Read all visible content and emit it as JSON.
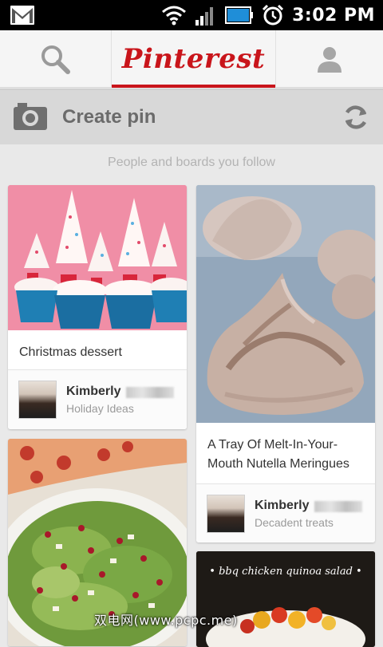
{
  "status_bar": {
    "time": "3:02 PM",
    "icons": [
      "gmail-icon",
      "wifi-icon",
      "signal-icon",
      "battery-icon",
      "alarm-icon"
    ]
  },
  "topbar": {
    "logo": "Pinterest",
    "tabs": [
      "search-icon",
      "pinterest-logo",
      "profile-icon"
    ],
    "accent": "#c9151b"
  },
  "create_bar": {
    "label": "Create pin",
    "icons": [
      "camera-icon",
      "refresh-icon"
    ]
  },
  "feed": {
    "section_title": "People and boards you follow",
    "pins": [
      {
        "description": "Christmas dessert",
        "owner": "Kimberly",
        "board": "Holiday Ideas",
        "image": "cupcakes with tree toppers"
      },
      {
        "description": "A Tray Of Melt-In-Your-Mouth Nutella Meringues",
        "owner": "Kimberly",
        "board": "Decadent treats",
        "image": "nutella meringue"
      },
      {
        "description": "",
        "image": "salad"
      },
      {
        "description": "",
        "image": "bbq chicken quinoa salad",
        "image_text": "• bbq chicken quinoa salad •"
      }
    ]
  },
  "watermark": "双电网(www.pcpc.me)"
}
